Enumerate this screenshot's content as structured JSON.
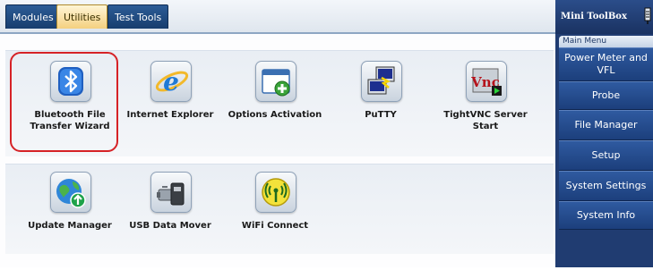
{
  "tabs": [
    {
      "label": "Modules",
      "active": false
    },
    {
      "label": "Utilities",
      "active": true
    },
    {
      "label": "Test Tools",
      "active": false
    }
  ],
  "utilities": [
    {
      "label": "Bluetooth File Transfer Wizard",
      "icon": "bluetooth-icon",
      "highlighted": true
    },
    {
      "label": "Internet Explorer",
      "icon": "internet-explorer-icon"
    },
    {
      "label": "Options Activation",
      "icon": "options-activation-icon"
    },
    {
      "label": "PuTTY",
      "icon": "putty-icon"
    },
    {
      "label": "TightVNC Server Start",
      "icon": "tightvnc-icon"
    },
    {
      "label": "Update Manager",
      "icon": "update-manager-icon"
    },
    {
      "label": "USB Data Mover",
      "icon": "usb-data-mover-icon"
    },
    {
      "label": "WiFi Connect",
      "icon": "wifi-connect-icon"
    }
  ],
  "highlight_color": "#d62226",
  "sidebar": {
    "title": "Mini ToolBox",
    "section": "Main Menu",
    "items": [
      {
        "label": "Power Meter and VFL"
      },
      {
        "label": "Probe"
      },
      {
        "label": "File Manager"
      },
      {
        "label": "Setup"
      },
      {
        "label": "System Settings"
      },
      {
        "label": "System Info"
      }
    ]
  }
}
